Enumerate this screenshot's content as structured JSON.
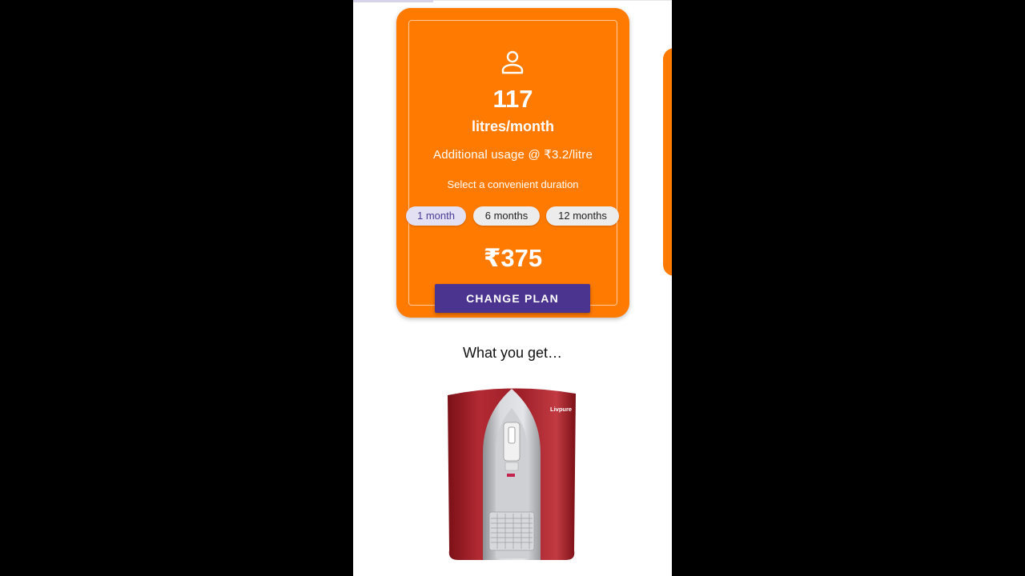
{
  "plan": {
    "litres": "117",
    "unit": "litres/month",
    "additional_usage": "Additional usage @ ₹3.2/litre",
    "duration_label": "Select a convenient duration",
    "durations": [
      {
        "label": "1 month",
        "selected": true
      },
      {
        "label": "6 months",
        "selected": false
      },
      {
        "label": "12 months",
        "selected": false
      }
    ],
    "price": "₹375",
    "change_plan_label": "CHANGE PLAN"
  },
  "section": {
    "title": "What you get…"
  },
  "product": {
    "brand": "Livpure"
  },
  "icons": {
    "user": "user-icon"
  },
  "colors": {
    "card_orange": "#ff7a00",
    "button_purple": "#4b3390",
    "chip_selected_bg": "#e4e0f3",
    "chip_bg": "#ececec",
    "product_red": "#a6222a"
  }
}
